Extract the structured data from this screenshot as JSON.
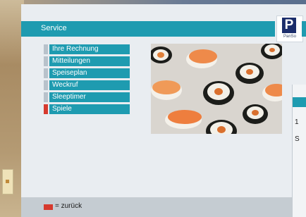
{
  "header": {
    "title": "Service",
    "logo_letter": "P",
    "logo_text": "PanSo"
  },
  "menu": {
    "items": [
      {
        "label": "Ihre Rechnung",
        "selected": false
      },
      {
        "label": "Mitteilungen",
        "selected": false
      },
      {
        "label": "Speiseplan",
        "selected": false
      },
      {
        "label": "Weckruf",
        "selected": false
      },
      {
        "label": "Sleeptimer",
        "selected": false
      },
      {
        "label": "Spiele",
        "selected": true
      }
    ]
  },
  "overlay": {
    "line1": "1",
    "line2": "S"
  },
  "footer": {
    "back_label": "= zurück",
    "key_color": "#d63a2e"
  },
  "colors": {
    "accent": "#1e9bb0",
    "selected_marker": "#d63a2e",
    "background": "#e9edf1"
  }
}
